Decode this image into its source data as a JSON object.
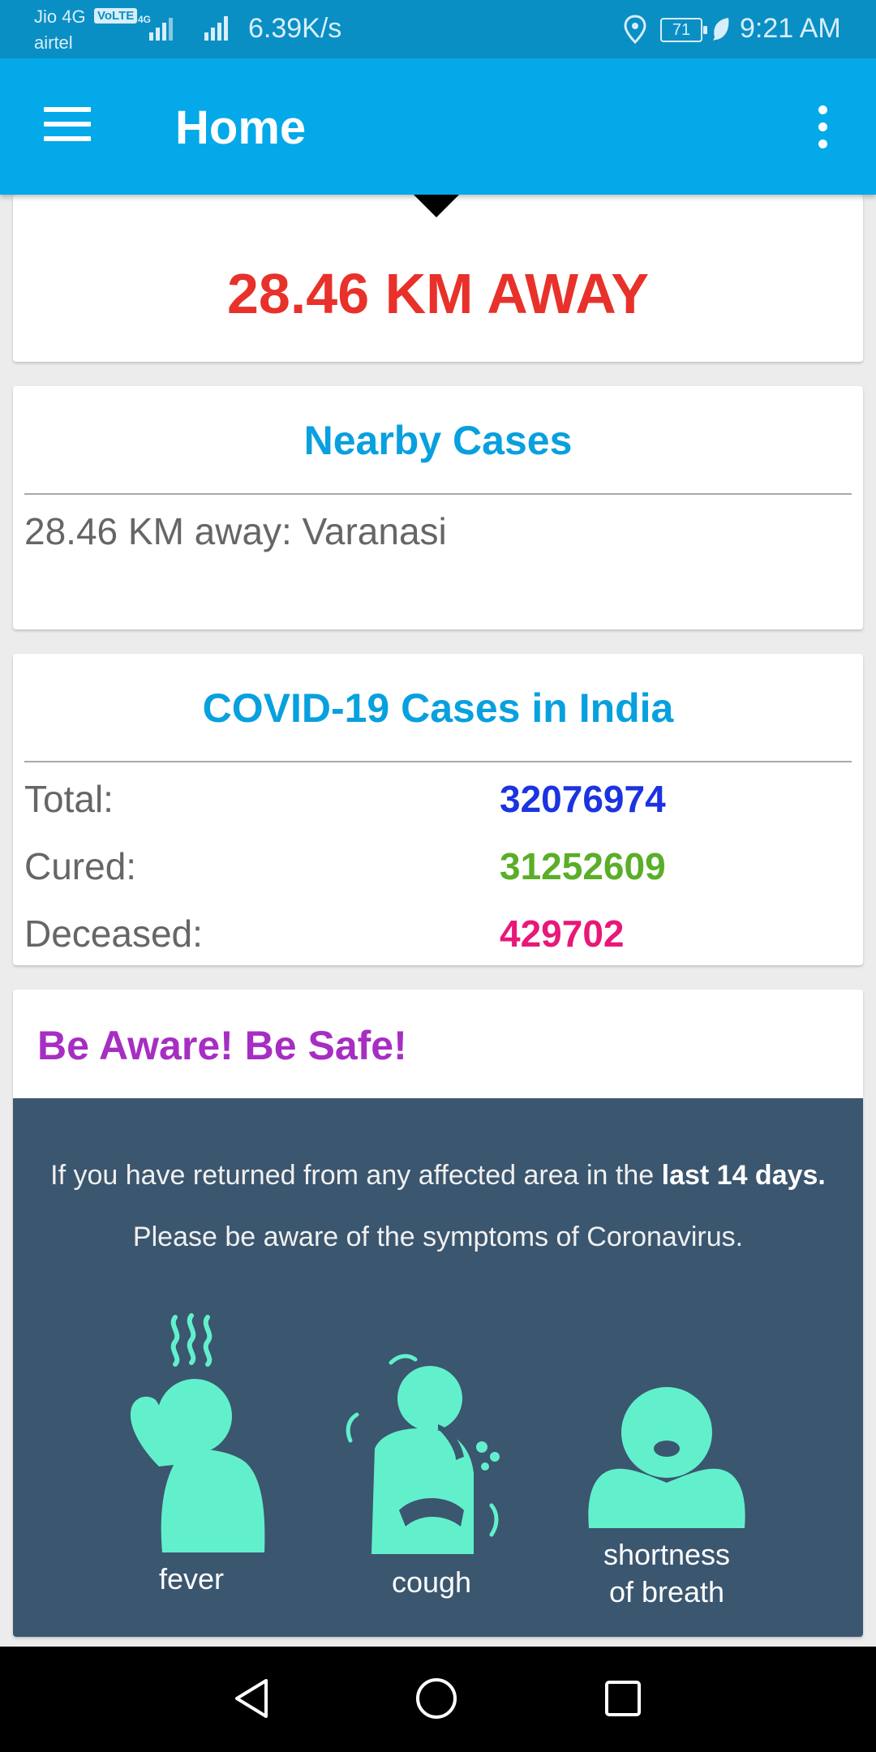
{
  "status_bar": {
    "carrier_primary": "Jio 4G",
    "volte_badge": "VoLTE",
    "carrier_secondary": "airtel",
    "net_speed": "6.39K/s",
    "battery": "71",
    "time": "9:21 AM"
  },
  "app_bar": {
    "title": "Home"
  },
  "distance_card": {
    "distance_text": "28.46 KM AWAY"
  },
  "nearby_card": {
    "title": "Nearby Cases",
    "items": [
      "28.46 KM away: Varanasi"
    ]
  },
  "covid_card": {
    "title": "COVID-19 Cases in India",
    "stats": [
      {
        "label": "Total:",
        "value": "32076974",
        "color": "#1b33e0"
      },
      {
        "label": "Cured:",
        "value": "31252609",
        "color": "#5aae28"
      },
      {
        "label": "Deceased:",
        "value": "429702",
        "color": "#e81779"
      }
    ]
  },
  "aware_card": {
    "title": "Be Aware! Be Safe!",
    "info_line1_prefix": "If you have returned from any affected area in the ",
    "info_line1_bold": "last 14 days.",
    "info_line2": "Please be aware of the symptoms of Coronavirus.",
    "symptoms": [
      {
        "label": "fever",
        "icon": "fever-icon"
      },
      {
        "label": "cough",
        "icon": "cough-icon"
      },
      {
        "label_line1": "shortness",
        "label_line2": "of breath",
        "icon": "shortness-of-breath-icon"
      }
    ]
  },
  "colors": {
    "status_bar": "#0a8fc4",
    "app_bar": "#03a9e9",
    "distance": "#e8312a",
    "card_title": "#08a0de",
    "aware_title": "#a62ec2",
    "infographic_bg": "#3b566f",
    "figure": "#62f0cc"
  }
}
